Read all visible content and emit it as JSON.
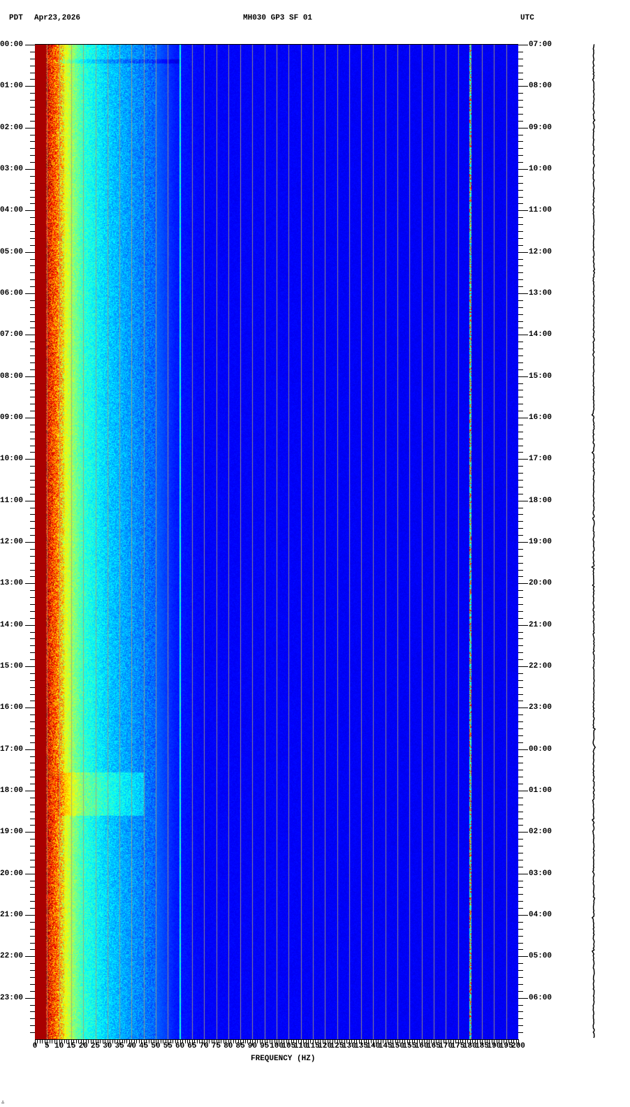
{
  "header": {
    "left_timezone": "PDT",
    "date": "Apr23,2026",
    "station": "MH030 GP3 SF 01",
    "right_timezone": "UTC"
  },
  "footer_mark": "∴",
  "chart_data": {
    "type": "heatmap",
    "title": "MH030 GP3 SF 01",
    "xlabel": "FREQUENCY (HZ)",
    "xlim": [
      0,
      200
    ],
    "x_ticks": [
      "0",
      "5",
      "10",
      "15",
      "20",
      "25",
      "30",
      "35",
      "40",
      "45",
      "50",
      "55",
      "60",
      "65",
      "70",
      "75",
      "80",
      "85",
      "90",
      "95",
      "100",
      "105",
      "110",
      "115",
      "120",
      "125",
      "130",
      "135",
      "140",
      "145",
      "150",
      "155",
      "160",
      "165",
      "170",
      "175",
      "180",
      "185",
      "190",
      "195",
      "200"
    ],
    "ylabel_left": "PDT",
    "ylabel_right": "UTC",
    "ylim_hours": [
      0,
      24
    ],
    "y_ticks_left": [
      "00:00",
      "01:00",
      "02:00",
      "03:00",
      "04:00",
      "05:00",
      "06:00",
      "07:00",
      "08:00",
      "09:00",
      "10:00",
      "11:00",
      "12:00",
      "13:00",
      "14:00",
      "15:00",
      "16:00",
      "17:00",
      "18:00",
      "19:00",
      "20:00",
      "21:00",
      "22:00",
      "23:00"
    ],
    "y_ticks_right": [
      "07:00",
      "08:00",
      "09:00",
      "10:00",
      "11:00",
      "12:00",
      "13:00",
      "14:00",
      "15:00",
      "16:00",
      "17:00",
      "18:00",
      "19:00",
      "20:00",
      "21:00",
      "22:00",
      "23:00",
      "00:00",
      "01:00",
      "02:00",
      "03:00",
      "04:00",
      "05:00",
      "06:00"
    ],
    "grid": "vertical every 5 Hz",
    "colormap": "jet",
    "spectral_profile": {
      "freq_hz": [
        0,
        4,
        6,
        9,
        12,
        16,
        20,
        25,
        30,
        40,
        50,
        58,
        70,
        200
      ],
      "relative_power": [
        1.0,
        1.0,
        0.88,
        0.78,
        0.62,
        0.5,
        0.4,
        0.35,
        0.3,
        0.24,
        0.18,
        0.1,
        0.07,
        0.06
      ]
    },
    "spectral_lines_hz": [
      60,
      180
    ],
    "events": [
      {
        "start_hour": 0.35,
        "end_hour": 0.45,
        "note": "broadband dip"
      },
      {
        "start_hour": 17.55,
        "end_hour": 18.6,
        "note": "elevated 10-40 Hz"
      }
    ]
  }
}
